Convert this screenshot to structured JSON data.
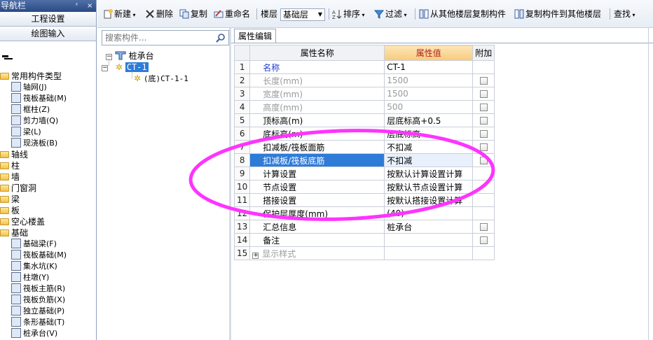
{
  "nav": {
    "title": "导航栏",
    "pin_label": "ᵖ",
    "close_label": "×",
    "buttons": [
      "工程设置",
      "绘图输入"
    ],
    "tree": [
      {
        "label": "常用构件类型",
        "level": 0,
        "type": "folder"
      },
      {
        "label": "轴网(J)",
        "level": 1,
        "type": "item"
      },
      {
        "label": "筏板基础(M)",
        "level": 1,
        "type": "item"
      },
      {
        "label": "框柱(Z)",
        "level": 1,
        "type": "item"
      },
      {
        "label": "剪力墙(Q)",
        "level": 1,
        "type": "item"
      },
      {
        "label": "梁(L)",
        "level": 1,
        "type": "item"
      },
      {
        "label": "现浇板(B)",
        "level": 1,
        "type": "item"
      },
      {
        "label": "轴线",
        "level": 0,
        "type": "folder"
      },
      {
        "label": "柱",
        "level": 0,
        "type": "folder"
      },
      {
        "label": "墙",
        "level": 0,
        "type": "folder"
      },
      {
        "label": "门窗洞",
        "level": 0,
        "type": "folder"
      },
      {
        "label": "梁",
        "level": 0,
        "type": "folder"
      },
      {
        "label": "板",
        "level": 0,
        "type": "folder"
      },
      {
        "label": "空心楼盖",
        "level": 0,
        "type": "folder"
      },
      {
        "label": "基础",
        "level": 0,
        "type": "folder"
      },
      {
        "label": "基础梁(F)",
        "level": 1,
        "type": "item"
      },
      {
        "label": "筏板基础(M)",
        "level": 1,
        "type": "item"
      },
      {
        "label": "集水坑(K)",
        "level": 1,
        "type": "item"
      },
      {
        "label": "柱墩(Y)",
        "level": 1,
        "type": "item"
      },
      {
        "label": "筏板主筋(R)",
        "level": 1,
        "type": "item"
      },
      {
        "label": "筏板负筋(X)",
        "level": 1,
        "type": "item"
      },
      {
        "label": "独立基础(P)",
        "level": 1,
        "type": "item"
      },
      {
        "label": "条形基础(T)",
        "level": 1,
        "type": "item"
      },
      {
        "label": "桩承台(V)",
        "level": 1,
        "type": "item"
      }
    ]
  },
  "toolbar": {
    "new_label": "新建",
    "delete_label": "删除",
    "copy_label": "复制",
    "rename_label": "重命名",
    "floor_label": "楼层",
    "floor_value": "基础层",
    "sort_label": "排序",
    "filter_label": "过滤",
    "copy_from_label": "从其他楼层复制构件",
    "copy_to_label": "复制构件到其他楼层",
    "find_label": "查找"
  },
  "search": {
    "placeholder": "搜索构件..."
  },
  "component_tree": {
    "root": "桩承台",
    "child": "CT-1",
    "grandchild": "(底)CT-1-1"
  },
  "property_tab": {
    "label": "属性编辑"
  },
  "grid": {
    "headers": {
      "name": "属性名称",
      "value": "属性值",
      "extra": "附加"
    },
    "rows": [
      {
        "n": "1",
        "name": "名称",
        "value": "CT-1",
        "checkbox": false,
        "style": "blue"
      },
      {
        "n": "2",
        "name": "长度(mm)",
        "value": "1500",
        "checkbox": true,
        "style": "grey"
      },
      {
        "n": "3",
        "name": "宽度(mm)",
        "value": "1500",
        "checkbox": true,
        "style": "grey"
      },
      {
        "n": "4",
        "name": "高度(mm)",
        "value": "500",
        "checkbox": true,
        "style": "grey"
      },
      {
        "n": "5",
        "name": "顶标高(m)",
        "value": "层底标高+0.5",
        "checkbox": true,
        "style": ""
      },
      {
        "n": "6",
        "name": "底标高(m)",
        "value": "层底标高",
        "checkbox": true,
        "style": ""
      },
      {
        "n": "7",
        "name": "扣减板/筏板面筋",
        "value": "不扣减",
        "checkbox": true,
        "style": ""
      },
      {
        "n": "8",
        "name": "扣减板/筏板底筋",
        "value": "不扣减",
        "checkbox": true,
        "style": "selected"
      },
      {
        "n": "9",
        "name": "计算设置",
        "value": "按默认计算设置计算",
        "checkbox": false,
        "style": ""
      },
      {
        "n": "10",
        "name": "节点设置",
        "value": "按默认节点设置计算",
        "checkbox": false,
        "style": ""
      },
      {
        "n": "11",
        "name": "搭接设置",
        "value": "按默认搭接设置计算",
        "checkbox": false,
        "style": ""
      },
      {
        "n": "12",
        "name": "保护层厚度(mm)",
        "value": "(40)",
        "checkbox": false,
        "style": ""
      },
      {
        "n": "13",
        "name": "汇总信息",
        "value": "桩承台",
        "checkbox": true,
        "style": ""
      },
      {
        "n": "14",
        "name": "备注",
        "value": "",
        "checkbox": true,
        "style": ""
      },
      {
        "n": "15",
        "name": "显示样式",
        "value": "",
        "checkbox": false,
        "style": "group"
      }
    ]
  },
  "colors": {
    "annotation": "#ff33ff",
    "selection": "#2f7bd8",
    "header_value": "#f7cb7b"
  }
}
